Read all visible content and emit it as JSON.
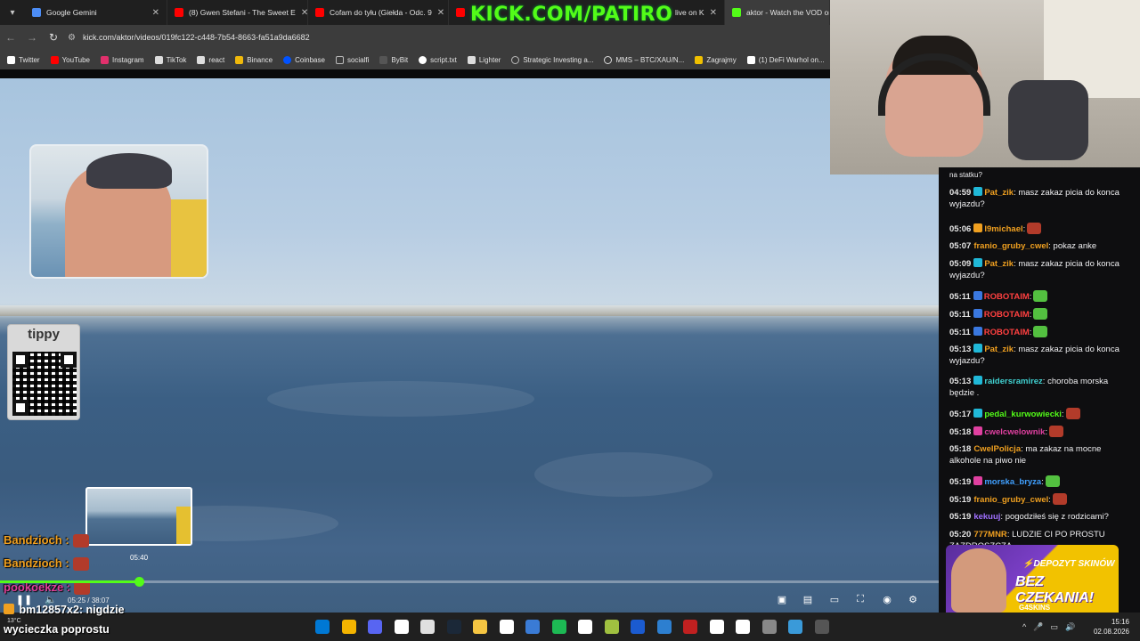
{
  "browser": {
    "tabs": [
      {
        "label": "Google Gemini",
        "color": "#4c8df6",
        "active": false
      },
      {
        "label": "(8) Gwen Stefani - The Sweet E",
        "color": "#ff0000",
        "active": false
      },
      {
        "label": "Cofam do tyłu (Giełda - Odc. 9",
        "color": "#ff0000",
        "active": false
      },
      {
        "label": "live on K",
        "color": "#ff0000",
        "active": false
      },
      {
        "label": "aktor - Watch the VOD on",
        "color": "#53fc18",
        "active": true
      }
    ],
    "overlay_title": "KICK.COM/PATIRO",
    "url": "kick.com/aktor/videos/019fc122-c448-7b54-8663-fa51a9da6682",
    "bookmarks": [
      {
        "label": "Twitter",
        "color": "#1d9bf0"
      },
      {
        "label": "YouTube",
        "color": "#ff0000"
      },
      {
        "label": "Instagram",
        "color": "#e1306c"
      },
      {
        "label": "TikTok",
        "color": "#ffffff"
      },
      {
        "label": "react",
        "color": "#ffffff"
      },
      {
        "label": "Binance",
        "color": "#f0b90b"
      },
      {
        "label": "Coinbase",
        "color": "#0052ff"
      },
      {
        "label": "socialfi",
        "color": "#bbbbbb"
      },
      {
        "label": "ByBit",
        "color": "#f7a600"
      },
      {
        "label": "script.txt",
        "color": "#ffffff"
      },
      {
        "label": "Lighter",
        "color": "#ffffff"
      },
      {
        "label": "Strategic Investing a...",
        "color": "#bbbbbb"
      },
      {
        "label": "MMS – BTC/XAU/N...",
        "color": "#ffffff"
      },
      {
        "label": "Zagrajmy",
        "color": "#f0c000"
      },
      {
        "label": "(1) DeFi Warhol on...",
        "color": "#ffffff"
      }
    ]
  },
  "video": {
    "tippy_label": "tippy",
    "preview_time": "05:40",
    "time_readout": "05:25 / 38:07",
    "progress": 0.148,
    "overlay_chat": [
      {
        "user": "Bandzioch :",
        "color": "#f0a020",
        "emote_color": "#b23b2a"
      },
      {
        "user": "Bandzioch :",
        "color": "#f0a020",
        "emote_color": "#b23b2a"
      },
      {
        "user": "pookoekze :",
        "color": "#e0409a",
        "emote_color": "#b23b2a"
      }
    ],
    "bottom_chat": [
      {
        "user": "bm12857x2",
        "text": ": nigdzie"
      },
      {
        "user": "",
        "text": "wycieczka poprostu"
      }
    ]
  },
  "chat": {
    "top_fragment": "na statku?",
    "messages": [
      {
        "ts": "04:59",
        "user": "Pat_zik",
        "color": "#f0a020",
        "text": ": masz zakaz picia do konca wyjazdu?",
        "badge": "#20b8d8",
        "emote": ""
      },
      {
        "ts": "05:06",
        "user": "l9michael",
        "color": "#f0a020",
        "text": ":",
        "badge": "#f0a020",
        "emote": "#b23b2a"
      },
      {
        "ts": "05:07",
        "user": "franio_gruby_cwel",
        "color": "#f0a020",
        "text": ": pokaz anke",
        "badge": "",
        "emote": ""
      },
      {
        "ts": "05:09",
        "user": "Pat_zik",
        "color": "#f0a020",
        "text": ": masz zakaz picia do konca wyjazdu?",
        "badge": "#20b8d8",
        "emote": ""
      },
      {
        "ts": "05:11",
        "user": "ROBOTAIM",
        "color": "#ff4040",
        "text": ":",
        "badge": "#3a78e0",
        "emote": "#53c040"
      },
      {
        "ts": "05:11",
        "user": "ROBOTAIM",
        "color": "#ff4040",
        "text": ":",
        "badge": "#3a78e0",
        "emote": "#53c040"
      },
      {
        "ts": "05:11",
        "user": "ROBOTAIM",
        "color": "#ff4040",
        "text": ":",
        "badge": "#3a78e0",
        "emote": "#53c040"
      },
      {
        "ts": "05:13",
        "user": "Pat_zik",
        "color": "#f0a020",
        "text": ": masz zakaz picia do konca wyjazdu?",
        "badge": "#20b8d8",
        "emote": ""
      },
      {
        "ts": "05:13",
        "user": "raidersramirez",
        "color": "#40d0d0",
        "text": ": choroba morska będzie .",
        "badge": "#20b8d8",
        "emote": ""
      },
      {
        "ts": "05:17",
        "user": "pedal_kurwowiecki",
        "color": "#53fc18",
        "text": ":",
        "badge": "#20b8d8",
        "emote": "#b23b2a"
      },
      {
        "ts": "05:18",
        "user": "cwelcwelownik",
        "color": "#e040a0",
        "text": ":",
        "badge": "#e040a0",
        "emote": "#b23b2a"
      },
      {
        "ts": "05:18",
        "user": "CwelPolicja",
        "color": "#f0a020",
        "text": ": ma zakaz na mocne alkohole na piwo nie",
        "badge": "",
        "emote": ""
      },
      {
        "ts": "05:19",
        "user": "morska_bryza",
        "color": "#40a0ff",
        "text": ":",
        "badge": "#e040a0",
        "emote": "#53c040"
      },
      {
        "ts": "05:19",
        "user": "franio_gruby_cwel",
        "color": "#f0a020",
        "text": ":",
        "badge": "",
        "emote": "#b23b2a"
      },
      {
        "ts": "05:19",
        "user": "kekuuj",
        "color": "#a070ff",
        "text": ": pogodziłeś się z rodzicami?",
        "badge": "",
        "emote": ""
      },
      {
        "ts": "05:20",
        "user": "777MNR",
        "color": "#f0a020",
        "text": ": LUDZIE CI PO PROSTU ZAZDROSZCZA",
        "badge": "",
        "emote": ""
      }
    ]
  },
  "promo": {
    "line1": "⚡DEPOZYT SKINÓW",
    "line2": "BEZ CZEKANIA!",
    "brand": "G4SKINS"
  },
  "taskbar": {
    "temp": "13°C",
    "time": "15:16",
    "date": "02.08.2026",
    "icons": [
      "#0078d4",
      "#f4b400",
      "#5865f2",
      "#ffffff",
      "#e0e0e0",
      "#1b2838",
      "#f5c542",
      "#ffffff",
      "#3a7bd5",
      "#1db954",
      "#ffffff",
      "#a0c040",
      "#1b5bd0",
      "#2d7fd0",
      "#c02020",
      "#ffffff",
      "#ffffff",
      "#888888",
      "#3a9ad9",
      "#555555"
    ]
  }
}
